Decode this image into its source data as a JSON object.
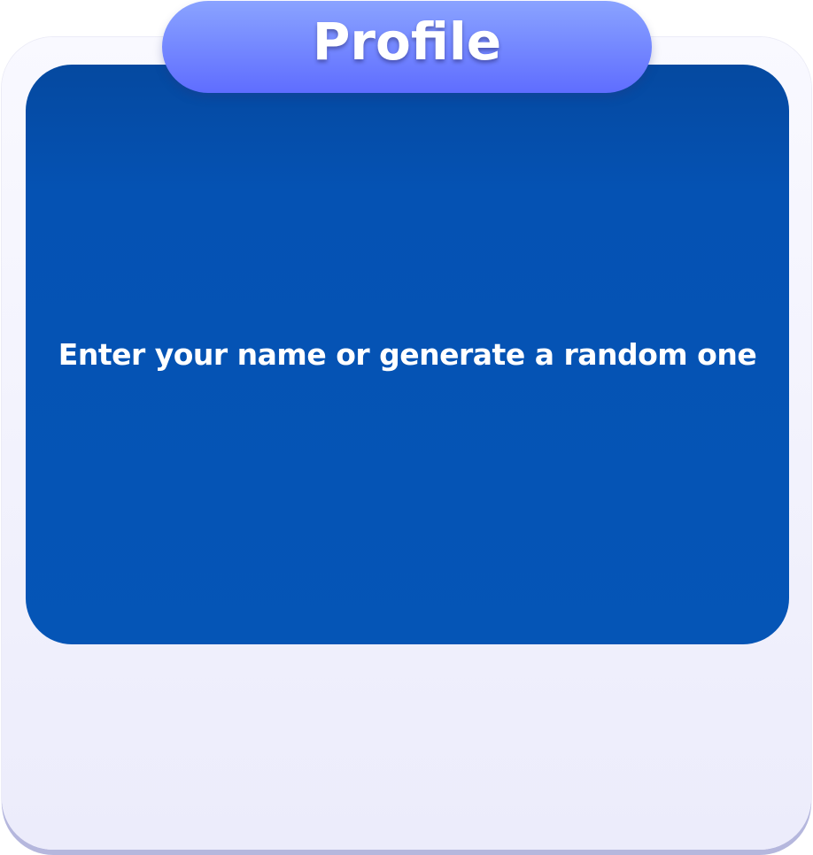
{
  "dialog": {
    "title": "Profile",
    "message": "Enter your name or generate a random one"
  },
  "colors": {
    "title_pill_top": "#8aa3ff",
    "title_pill_bottom": "#5f6dff",
    "panel": "#0555b6",
    "card_background": "#f0f0fb",
    "text": "#ffffff"
  }
}
